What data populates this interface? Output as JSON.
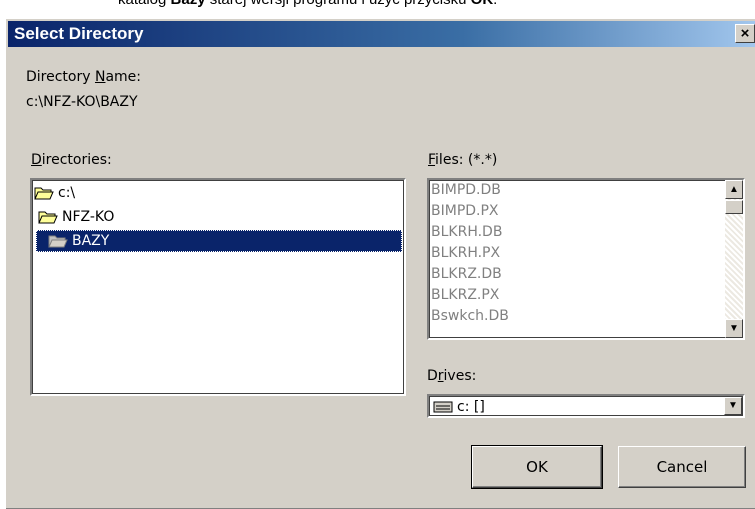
{
  "doc": {
    "text_before": "katalog ",
    "bold1": "Bazy",
    "text_middle": " starej wersji programu i użyć przycisku ",
    "bold2": "OK",
    "text_end": "."
  },
  "dialog": {
    "title": "Select Directory",
    "close_label": "×",
    "directory_name_label_pre": "Directory ",
    "directory_name_label_u": "N",
    "directory_name_label_post": "ame:",
    "directory_name_value": "c:\\NFZ-KO\\BAZY",
    "directories_label_u": "D",
    "directories_label_post": "irectories:",
    "directories": [
      {
        "name": "c:\\",
        "state": "open",
        "selected": false
      },
      {
        "name": "NFZ-KO",
        "state": "open",
        "selected": false
      },
      {
        "name": "BAZY",
        "state": "open",
        "selected": true
      }
    ],
    "files_label_u": "F",
    "files_label_post": "iles: (*.*)",
    "files": [
      "BIMPD.DB",
      "BIMPD.PX",
      "BLKRH.DB",
      "BLKRH.PX",
      "BLKRZ.DB",
      "BLKRZ.PX",
      "Bswkch.DB"
    ],
    "drives_label_pre": "D",
    "drives_label_u": "r",
    "drives_label_post": "ives:",
    "drive_value": "c: []",
    "ok_label": "OK",
    "cancel_label": "Cancel"
  },
  "colors": {
    "title_bar": "#0a246a",
    "dialog_face": "#d4d0c8",
    "selection": "#0a246a"
  }
}
